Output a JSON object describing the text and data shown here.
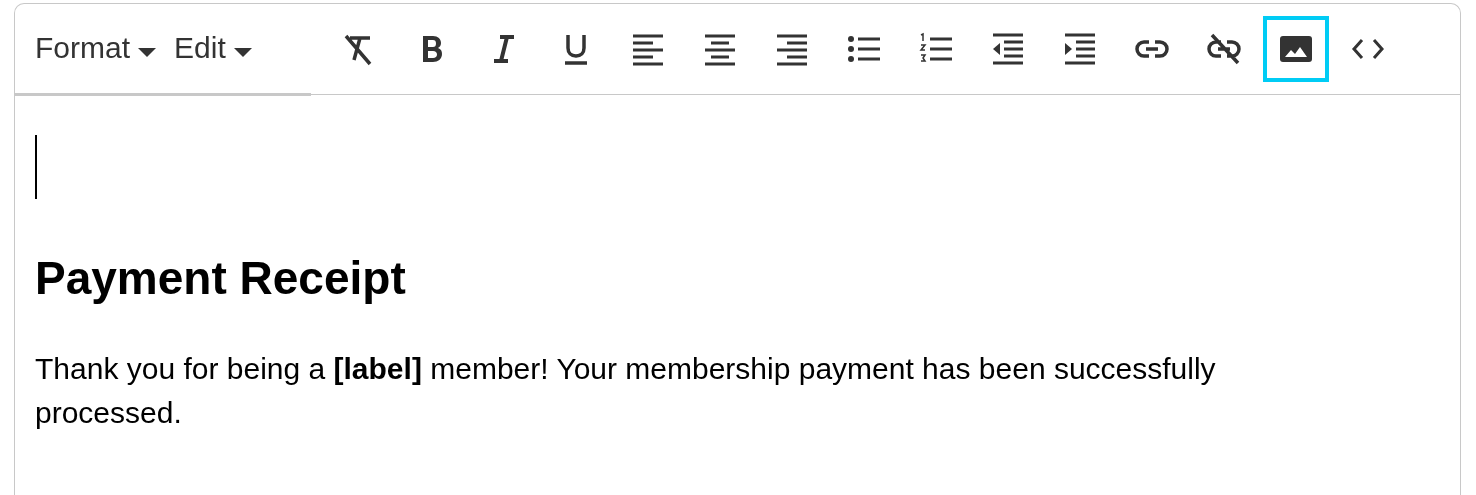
{
  "toolbar": {
    "menus": [
      {
        "label": "Format"
      },
      {
        "label": "Edit"
      }
    ],
    "tools": [
      {
        "kind": "clear-format",
        "selected": false
      },
      {
        "kind": "bold",
        "selected": false
      },
      {
        "kind": "italic",
        "selected": false
      },
      {
        "kind": "underline",
        "selected": false
      },
      {
        "kind": "align-left",
        "selected": false
      },
      {
        "kind": "align-center",
        "selected": false
      },
      {
        "kind": "align-right",
        "selected": false
      },
      {
        "kind": "bullet-list",
        "selected": false
      },
      {
        "kind": "numbered-list",
        "selected": false
      },
      {
        "kind": "outdent",
        "selected": false
      },
      {
        "kind": "indent",
        "selected": false
      },
      {
        "kind": "link",
        "selected": false
      },
      {
        "kind": "unlink",
        "selected": false
      },
      {
        "kind": "image",
        "selected": true
      },
      {
        "kind": "code",
        "selected": false
      }
    ]
  },
  "content": {
    "heading": "Payment Receipt",
    "paragraph": "Thank you for being a **[label]** member! Your membership payment has been successfully processed."
  }
}
